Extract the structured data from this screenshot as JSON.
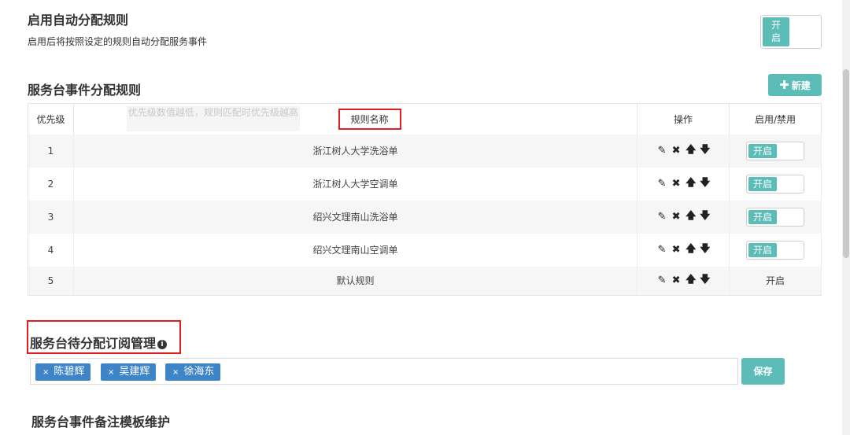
{
  "auto_assign": {
    "title": "启用自动分配规则",
    "description": "启用后将按照设定的规则自动分配服务事件",
    "switch_on_label": "开\n启"
  },
  "rules": {
    "title": "服务台事件分配规则",
    "new_button": "新建",
    "headers": {
      "priority": "优先级",
      "priority_hint": "优先级数值越低，规则匹配时优先级越高",
      "name": "规则名称",
      "operation": "操作",
      "toggle": "启用/禁用"
    },
    "rows": [
      {
        "priority": "1",
        "name": "浙江树人大学洗浴单",
        "toggle": "开启"
      },
      {
        "priority": "2",
        "name": "浙江树人大学空调单",
        "toggle": "开启"
      },
      {
        "priority": "3",
        "name": "绍兴文理南山洗浴单",
        "toggle": "开启"
      },
      {
        "priority": "4",
        "name": "绍兴文理南山空调单",
        "toggle": "开启"
      },
      {
        "priority": "5",
        "name": "默认规则",
        "toggle": "开启"
      }
    ]
  },
  "subscription": {
    "title": "服务台待分配订阅管理",
    "tags": [
      "陈碧辉",
      "吴建辉",
      "徐海东"
    ],
    "tag_remove_symbol": "×",
    "save_button": "保存"
  },
  "remarks": {
    "title": "服务台事件备注模板维护"
  },
  "colors": {
    "accent": "#5bbcb8",
    "tag": "#3d85c6",
    "highlight_border": "#e02020"
  }
}
